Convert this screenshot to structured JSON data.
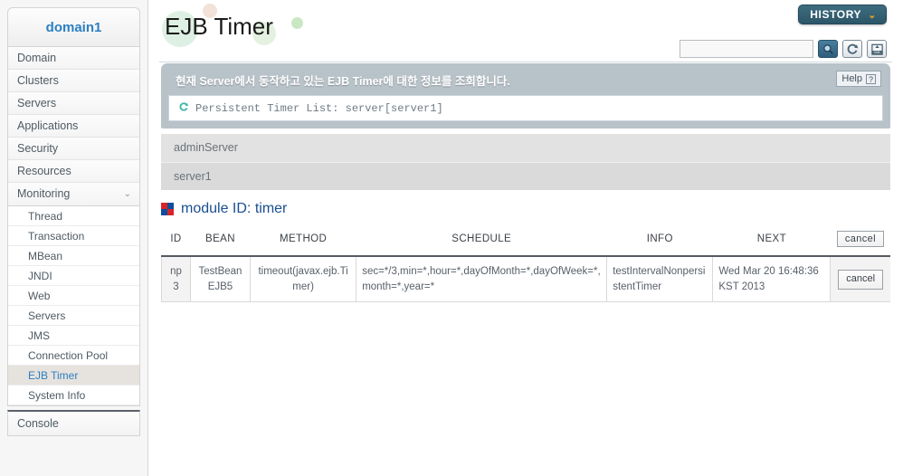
{
  "sidebar": {
    "domain_label": "domain1",
    "nav_items": [
      {
        "label": "Domain",
        "expandable": false
      },
      {
        "label": "Clusters",
        "expandable": false
      },
      {
        "label": "Servers",
        "expandable": false
      },
      {
        "label": "Applications",
        "expandable": false
      },
      {
        "label": "Security",
        "expandable": false
      },
      {
        "label": "Resources",
        "expandable": false
      },
      {
        "label": "Monitoring",
        "expandable": true,
        "chevron": "⌄"
      }
    ],
    "sub_items": [
      {
        "label": "Thread",
        "active": false
      },
      {
        "label": "Transaction",
        "active": false
      },
      {
        "label": "MBean",
        "active": false
      },
      {
        "label": "JNDI",
        "active": false
      },
      {
        "label": "Web",
        "active": false
      },
      {
        "label": "Servers",
        "active": false
      },
      {
        "label": "JMS",
        "active": false
      },
      {
        "label": "Connection Pool",
        "active": false
      },
      {
        "label": "EJB Timer",
        "active": true
      },
      {
        "label": "System Info",
        "active": false
      }
    ],
    "console_label": "Console"
  },
  "header": {
    "page_title": "EJB Timer",
    "history_label": "HISTORY",
    "history_chevron": "⌄"
  },
  "toolbar": {
    "search_value": "",
    "search_placeholder": "",
    "search_icon": "⌕",
    "refresh_icon": "↻",
    "xml_icon": "XML"
  },
  "banner": {
    "title": "현재 Server에서 동작하고 있는 EJB Timer에 대한 정보를 조회합니다.",
    "list_icon": "↻",
    "list_label": "Persistent Timer List: server[server1]",
    "help_label": "Help",
    "help_icon": "?"
  },
  "servers": [
    {
      "name": "adminServer",
      "tone": "light"
    },
    {
      "name": "server1",
      "tone": "dark"
    }
  ],
  "module": {
    "heading": "module ID: timer"
  },
  "table": {
    "columns": [
      "ID",
      "BEAN",
      "METHOD",
      "SCHEDULE",
      "INFO",
      "NEXT"
    ],
    "header_action_label": "cancel",
    "rows": [
      {
        "id": "np3",
        "bean": "TestBeanEJB5",
        "method": "timeout(javax.ejb.Timer)",
        "schedule": "sec=*/3,min=*,hour=*,dayOfMonth=*,dayOfWeek=*,month=*,year=*",
        "info": "testIntervalNonpersistentTimer",
        "next": "Wed Mar 20 16:48:36 KST 2013",
        "action_label": "cancel"
      }
    ]
  },
  "colors": {
    "accent_blue": "#2d7fc1",
    "module_blue": "#1a4f8f",
    "history_teal": "#2c5668",
    "history_chevron_orange": "#f0a423",
    "banner_gray": "#b8c2c9",
    "active_item_bg": "#e6e2de"
  }
}
